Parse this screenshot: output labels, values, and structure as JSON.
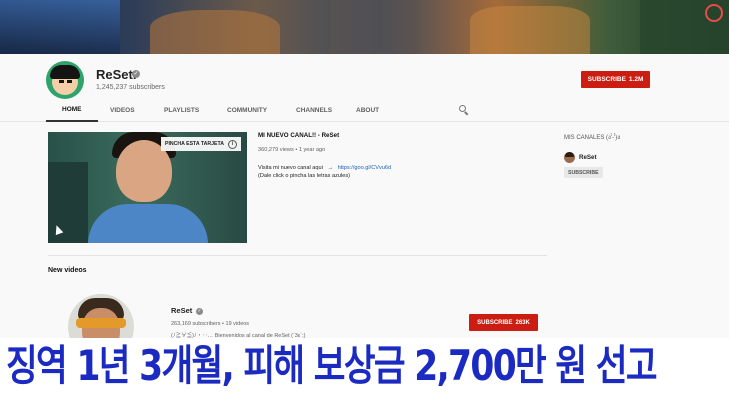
{
  "channel": {
    "name": "ReSet.",
    "subscribers": "1,245,237 subscribers",
    "subscribe_label": "SUBSCRIBE",
    "subscribe_count": "1.2M"
  },
  "tabs": [
    {
      "label": "HOME",
      "active": true
    },
    {
      "label": "VIDEOS",
      "active": false
    },
    {
      "label": "PLAYLISTS",
      "active": false
    },
    {
      "label": "COMMUNITY",
      "active": false
    },
    {
      "label": "CHANNELS",
      "active": false
    },
    {
      "label": "ABOUT",
      "active": false
    }
  ],
  "featured": {
    "card_tag": "PINCHA ESTA TARJETA",
    "title": "MI NUEVO CANAL!! - ReSet",
    "meta": "360,279 views • 1 year ago",
    "desc_line1": "Visita mi nuevo canal aqui",
    "desc_arrow": "→",
    "link": "https://goo.gl/CVvu6d",
    "desc_line2": "(Dale click o pincha las letras azules)"
  },
  "section": {
    "new_videos": "New videos"
  },
  "sidebar": {
    "title": "MIS CANALES (ง'̀-'́)ง",
    "item_name": "ReSet",
    "subscribe_label": "SUBSCRIBE"
  },
  "channel_card": {
    "name": "ReSet",
    "meta": "263,169 subscribers • 19 videos",
    "desc": "(ﾉ≧∀≦)ﾉ・‥… Bienvenidos al canal de ReSet (´3ε`;)",
    "subscribe_label": "SUBSCRIBE",
    "subscribe_count": "263K"
  },
  "caption": {
    "text": "징역 1년 3개월, 피해 보상금 2,700만 원 선고"
  },
  "colors": {
    "subscribe_red": "#cc1d12",
    "caption_blue": "#1b2bc2",
    "link_blue": "#1a5fbf"
  },
  "icons": {
    "verified": "check-badge-icon",
    "search": "search-icon",
    "info": "info-icon",
    "cursor": "mouse-cursor-icon"
  }
}
